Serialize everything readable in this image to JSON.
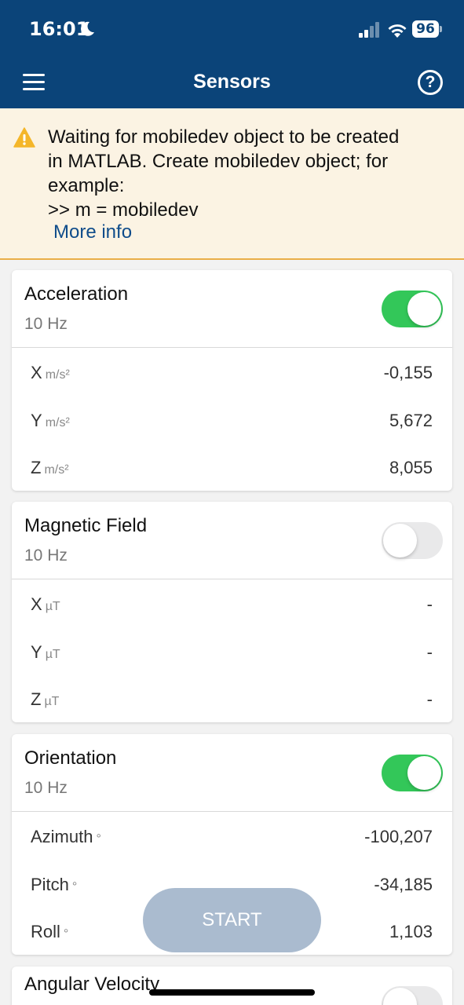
{
  "status_bar": {
    "time": "16:01",
    "battery": "96"
  },
  "header": {
    "title": "Sensors",
    "help_label": "?"
  },
  "banner": {
    "message_lines": [
      "Waiting for mobiledev object to be created",
      "in MATLAB. Create mobiledev object; for",
      "example:",
      ">> m = mobiledev"
    ],
    "link": "More info"
  },
  "sensors": [
    {
      "name": "Acceleration",
      "rate": "10 Hz",
      "enabled": true,
      "rows": [
        {
          "label": "X",
          "unit": "m/s²",
          "value": "-0,155"
        },
        {
          "label": "Y",
          "unit": "m/s²",
          "value": "5,672"
        },
        {
          "label": "Z",
          "unit": "m/s²",
          "value": "8,055"
        }
      ]
    },
    {
      "name": "Magnetic Field",
      "rate": "10 Hz",
      "enabled": false,
      "rows": [
        {
          "label": "X",
          "unit": "µT",
          "value": "-"
        },
        {
          "label": "Y",
          "unit": "µT",
          "value": "-"
        },
        {
          "label": "Z",
          "unit": "µT",
          "value": "-"
        }
      ]
    },
    {
      "name": "Orientation",
      "rate": "10 Hz",
      "enabled": true,
      "rows": [
        {
          "label": "Azimuth",
          "unit": "°",
          "value": "-100,207"
        },
        {
          "label": "Pitch",
          "unit": "°",
          "value": "-34,185"
        },
        {
          "label": "Roll",
          "unit": "°",
          "value": "1,103"
        }
      ]
    },
    {
      "name": "Angular Velocity",
      "enabled": false
    }
  ],
  "start_button": "START",
  "colors": {
    "header_bg": "#0b4479",
    "banner_bg": "#fbf3e3",
    "toggle_on": "#33c759",
    "link": "#0f4c8a",
    "start_bg": "#aabbcf"
  }
}
